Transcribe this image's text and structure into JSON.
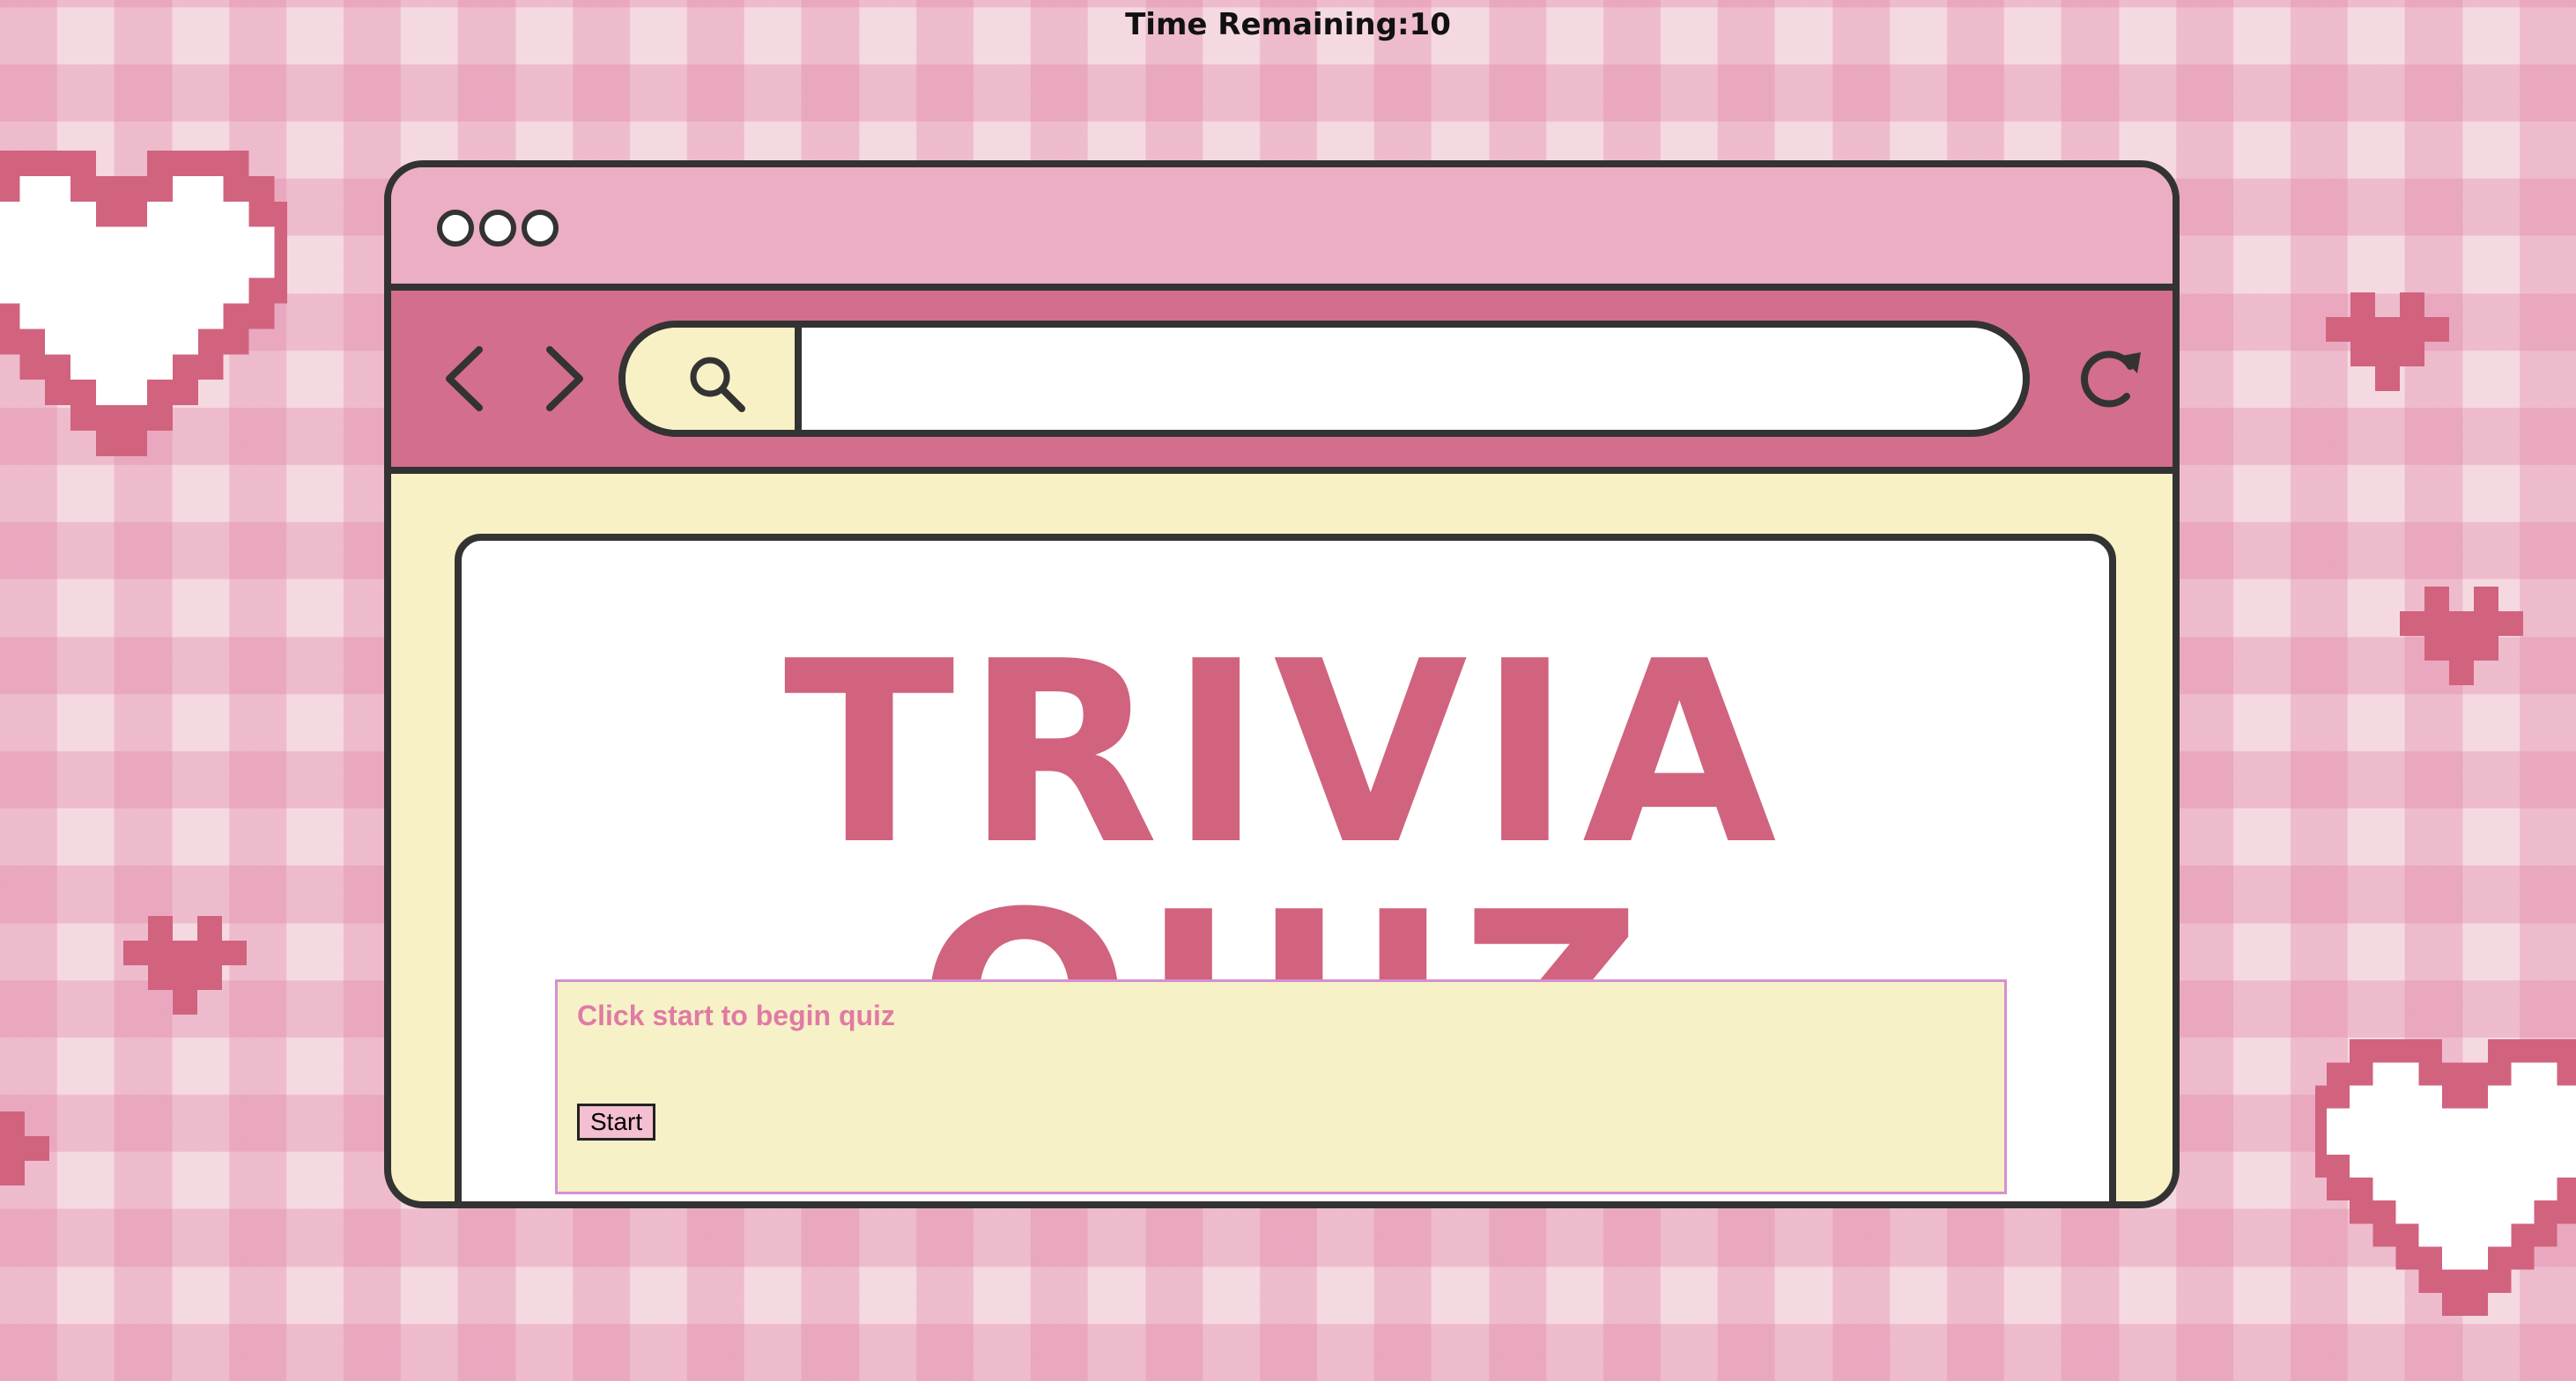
{
  "timer": {
    "label": "Time Remaining:",
    "value": "10"
  },
  "browser": {
    "search": {
      "value": "",
      "placeholder": ""
    }
  },
  "quiz": {
    "title": "TRIVIA QUIZ",
    "prompt": "Click start to begin quiz",
    "start_label": "Start"
  },
  "colors": {
    "accent_pink": "#d1637f",
    "navbar_pink": "#d46e8d",
    "titlebar_pink": "#ebaec4",
    "cream": "#f7f1c5",
    "prompt_pink": "#e07ba3",
    "outline": "#333333"
  },
  "icons": [
    "heart-icon",
    "window-dot-icon",
    "back-arrow-icon",
    "forward-arrow-icon",
    "search-icon",
    "refresh-icon"
  ]
}
